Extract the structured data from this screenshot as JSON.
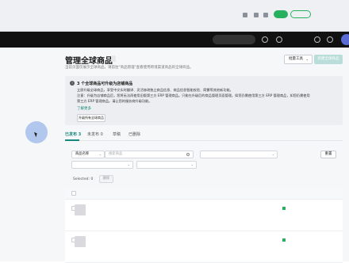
{
  "browser": {
    "url": "",
    "icons": [
      "star-icon",
      "extension-icon",
      "menu-icon"
    ]
  },
  "topbar": {
    "user_label": "",
    "chip_label": ""
  },
  "page": {
    "title": "管理全球商品",
    "title_badge": "",
    "subtitle": "当前页面仅展示全球商品，请前往\"商品管理\"查看使用跨境渠道商品的全球商品。",
    "batch_tools": "批量工具",
    "create_button": "新建全球商品"
  },
  "notice": {
    "title": "3 个全球商品可升级为店铺商品",
    "line1": "立即升级全球商品，享受中文实时翻译、灵活修改独立商品信息、商品信息智能校验、简繁等其他新功能。",
    "line2": "注意：升级为店铺商品后，您将无法再使用旧版第三方 ERP 管理商品。只能在升级后的商品管理页面管理。如您仍需使用第三方 ERP 管理商品，如您仍需使用",
    "line3": "第三方 ERP 管理商品。请让您的服务商升级功能。",
    "link": "了解更多",
    "button": "升级所有全球商品"
  },
  "tabs": [
    {
      "label": "已发布 3",
      "active": true
    },
    {
      "label": "未发布 0",
      "active": false
    },
    {
      "label": "草稿",
      "active": false
    },
    {
      "label": "已删除",
      "active": false
    }
  ],
  "filters": {
    "field_select": "商品名称",
    "search_placeholder": "搜索商品",
    "store_select": "",
    "category_select": "",
    "status_select": "",
    "reset": "重置"
  },
  "bulk": {
    "selected": "Selected: 0",
    "delete": "删除"
  },
  "table": {
    "columns": [
      "",
      "",
      "",
      "",
      "",
      "",
      "",
      ""
    ],
    "rows": [
      {
        "name": "",
        "col2": "",
        "col3": "",
        "col4": "",
        "col5": "",
        "actions": [
          "",
          ""
        ],
        "sku_label": ""
      },
      {
        "name": "",
        "col2": "",
        "col3": "",
        "col4": "",
        "col5": "",
        "actions": [
          "",
          ""
        ],
        "sku_label": ""
      }
    ]
  },
  "colors": {
    "accent": "#16877a",
    "green": "#27b15f",
    "topbar": "#111111"
  }
}
